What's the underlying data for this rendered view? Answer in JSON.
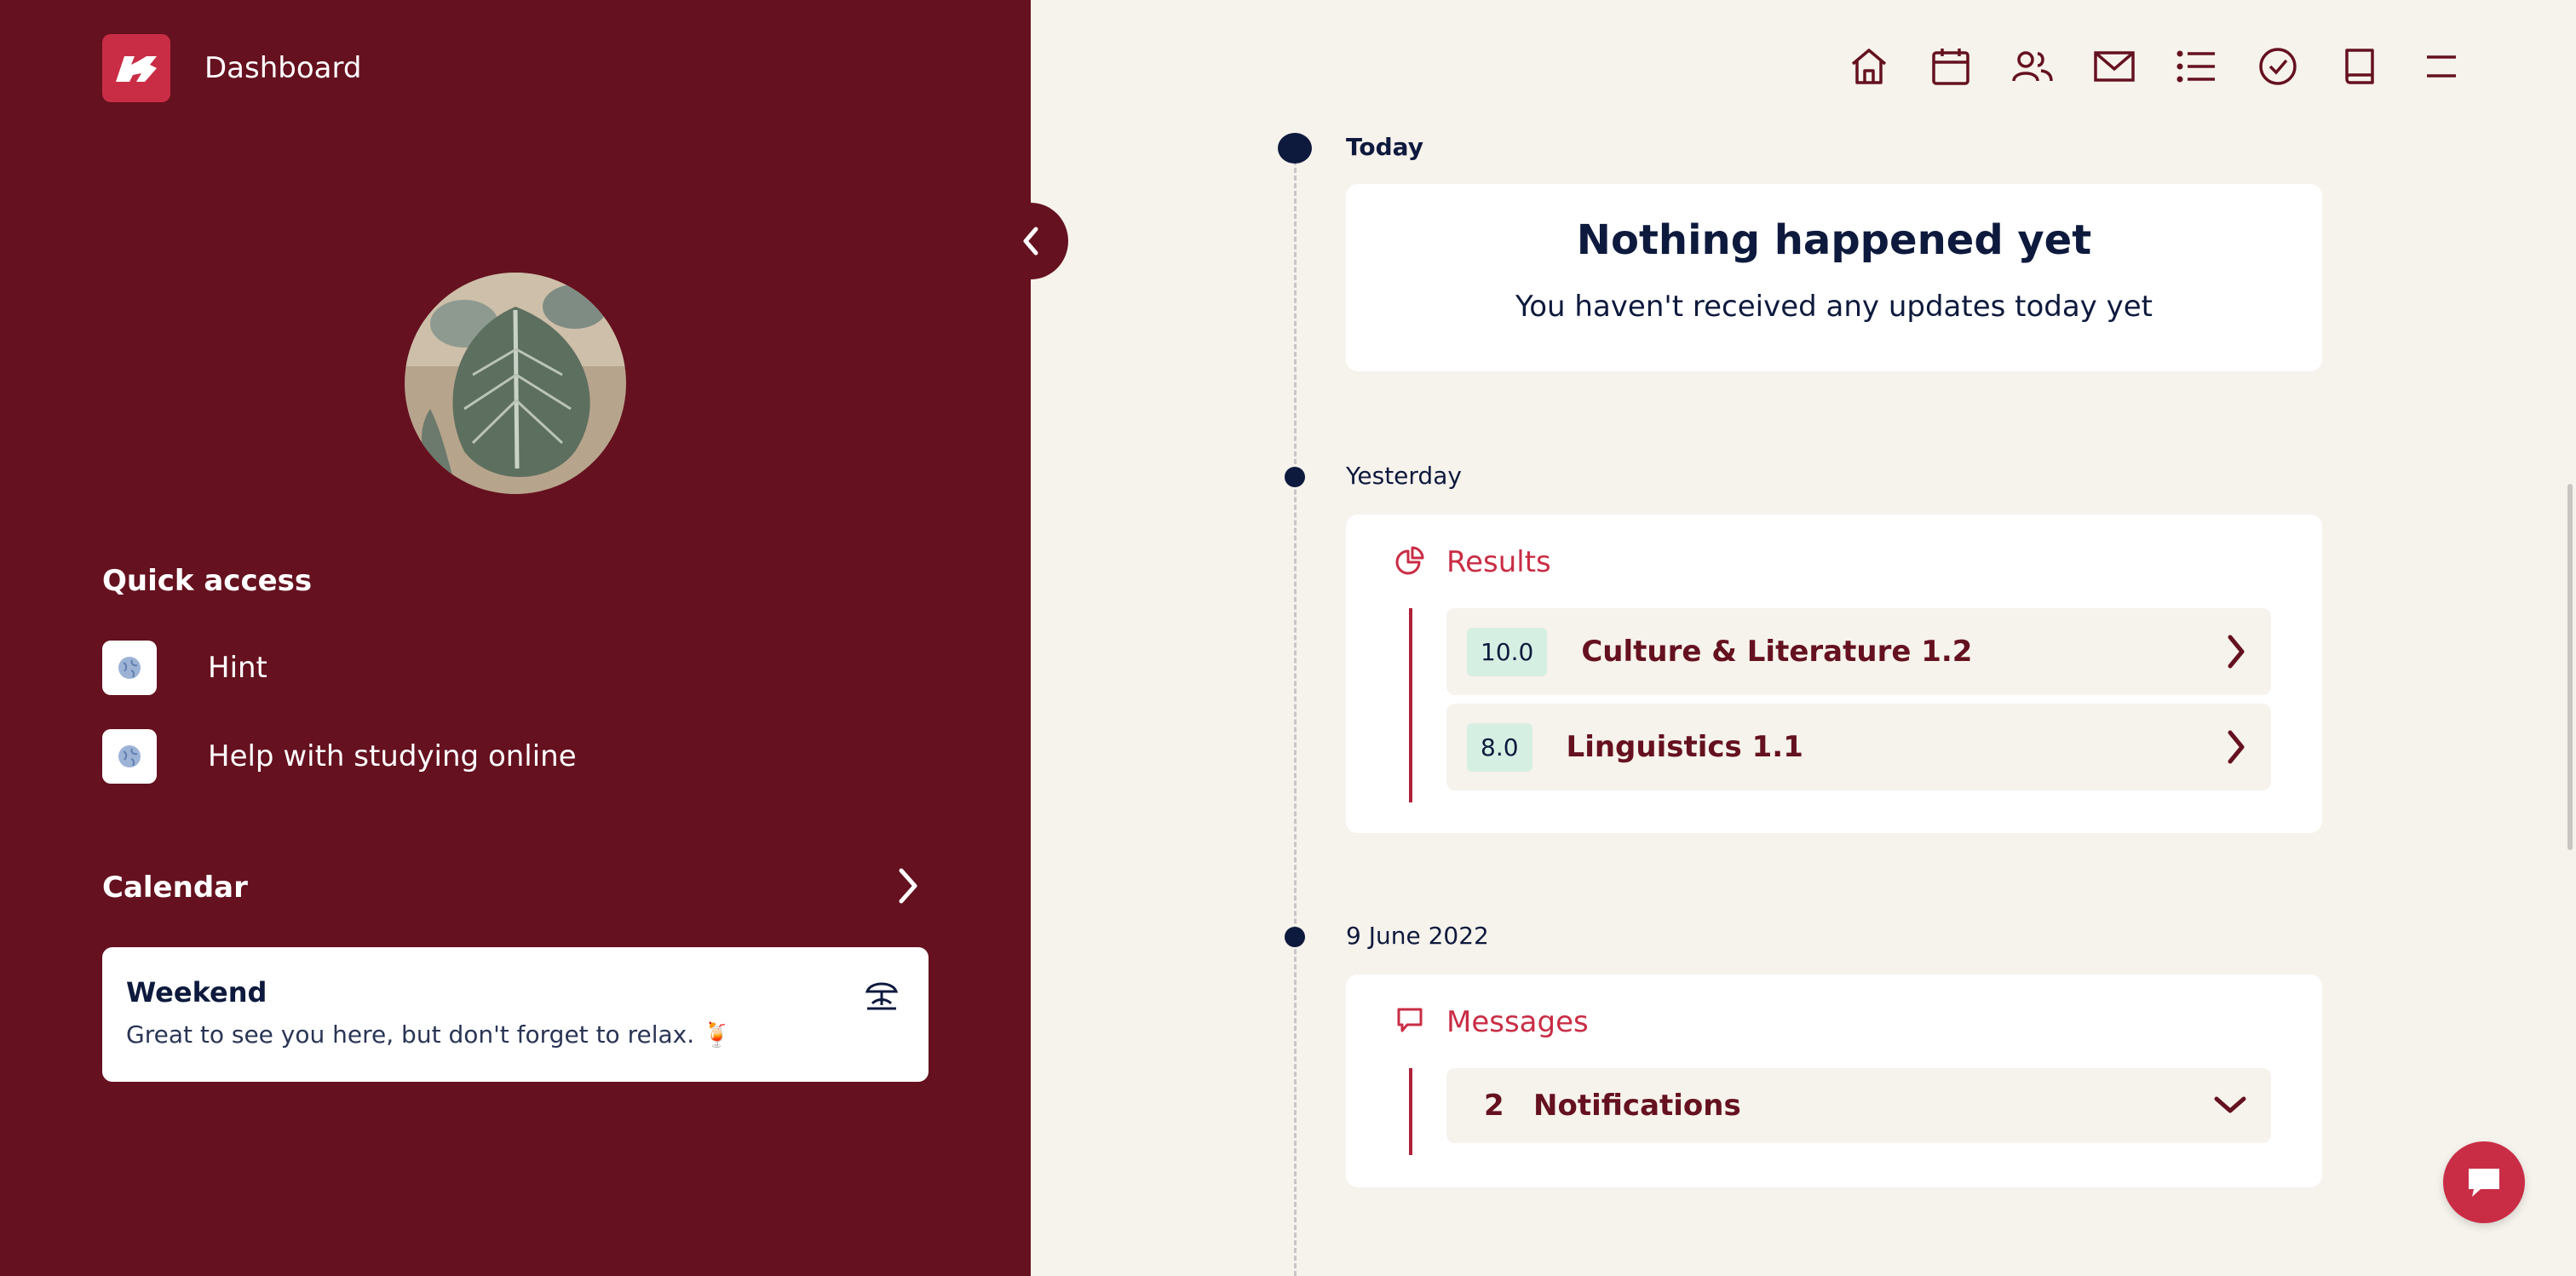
{
  "sidebar": {
    "title": "Dashboard",
    "quick_access": {
      "heading": "Quick access",
      "items": [
        {
          "label": "Hint",
          "icon": "globe-icon"
        },
        {
          "label": "Help with studying online",
          "icon": "globe-icon"
        }
      ]
    },
    "calendar": {
      "heading": "Calendar",
      "card_title": "Weekend",
      "card_text": "Great to see you here, but don't forget to relax. 🍹",
      "card_icon": "beach-umbrella-icon"
    }
  },
  "topnav": [
    "home-icon",
    "calendar-icon",
    "people-icon",
    "mail-icon",
    "list-icon",
    "check-circle-icon",
    "book-icon",
    "menu-icon"
  ],
  "timeline": {
    "today": {
      "label": "Today",
      "empty_title": "Nothing happened yet",
      "empty_text": "You haven't received any updates today yet"
    },
    "yesterday": {
      "label": "Yesterday",
      "section": "Results",
      "results": [
        {
          "grade": "10.0",
          "course": "Culture & Literature 1.2"
        },
        {
          "grade": "8.0",
          "course": "Linguistics 1.1"
        }
      ]
    },
    "june": {
      "label": "9 June 2022",
      "section": "Messages",
      "count": "2",
      "notifications": "Notifications"
    }
  },
  "colors": {
    "sidebar": "#65111f",
    "accent": "#c92d45",
    "navy": "#0e1a3d",
    "background": "#f6f2ec"
  }
}
